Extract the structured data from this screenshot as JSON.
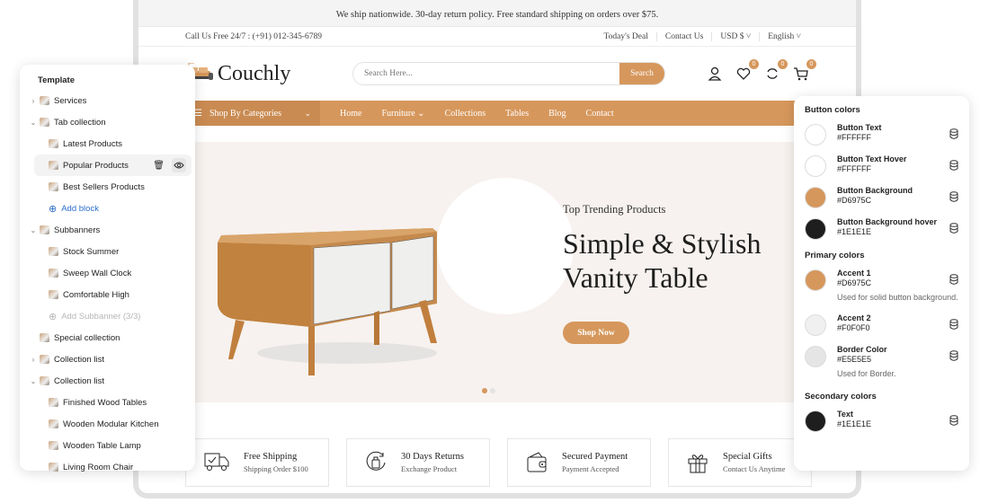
{
  "store": {
    "announcement": "We ship nationwide. 30-day return policy. Free standard shipping on orders over $75.",
    "phone": "Call Us Free 24/7 : (+91) 012-345-6789",
    "top_links": [
      "Today's Deal",
      "Contact Us",
      "USD $ ˅",
      "English ˅"
    ],
    "logo": "Couchly",
    "search": {
      "placeholder": "Search Here...",
      "button": "Search"
    },
    "header_icons": [
      {
        "name": "account-icon",
        "badge": null
      },
      {
        "name": "wishlist-icon",
        "badge": "0"
      },
      {
        "name": "compare-icon",
        "badge": "0"
      },
      {
        "name": "cart-icon",
        "badge": "0"
      }
    ],
    "categories_label": "Shop By Categories",
    "menu": [
      "Home",
      "Furniture",
      "Collections",
      "Tables",
      "Blog",
      "Contact"
    ],
    "hero": {
      "subtitle": "Top Trending Products",
      "title_line1": "Simple & Stylish",
      "title_line2": "Vanity Table",
      "button": "Shop Now",
      "slides": 2,
      "active_slide": 1
    },
    "services": [
      {
        "icon": "truck-icon",
        "title": "Free Shipping",
        "subtitle": "Shipping Order $100"
      },
      {
        "icon": "returns-icon",
        "title": "30 Days Returns",
        "subtitle": "Exchange Product"
      },
      {
        "icon": "wallet-icon",
        "title": "Secured Payment",
        "subtitle": "Payment Accepted"
      },
      {
        "icon": "gift-icon",
        "title": "Special Gifts",
        "subtitle": "Contact Us Anytime"
      }
    ]
  },
  "template_panel": {
    "title": "Template",
    "items": [
      {
        "label": "Services",
        "level": 1,
        "caret": ">"
      },
      {
        "label": "Tab collection",
        "level": 1,
        "caret": "v"
      },
      {
        "label": "Latest Products",
        "level": 2
      },
      {
        "label": "Popular Products",
        "level": 2,
        "selected": true
      },
      {
        "label": "Best Sellers Products",
        "level": 2
      },
      {
        "label": "Add block",
        "level": 2,
        "type": "add"
      },
      {
        "label": "Subbanners",
        "level": 1,
        "caret": "v"
      },
      {
        "label": "Stock Summer",
        "level": 2
      },
      {
        "label": "Sweep Wall Clock",
        "level": 2
      },
      {
        "label": "Comfortable High",
        "level": 2
      },
      {
        "label": "Add Subbanner (3/3)",
        "level": 2,
        "type": "add-disabled"
      },
      {
        "label": "Special collection",
        "level": 1
      },
      {
        "label": "Collection list",
        "level": 1,
        "caret": ">"
      },
      {
        "label": "Collection list",
        "level": 1,
        "caret": "v"
      },
      {
        "label": "Finished Wood Tables",
        "level": 2
      },
      {
        "label": "Wooden Modular Kitchen",
        "level": 2
      },
      {
        "label": "Wooden Table Lamp",
        "level": 2
      },
      {
        "label": "Living Room Chair",
        "level": 2
      }
    ]
  },
  "colors_panel": {
    "sections": [
      {
        "title": "Button colors",
        "swatches": [
          {
            "name": "Button Text",
            "hex": "#FFFFFF"
          },
          {
            "name": "Button Text Hover",
            "hex": "#FFFFFF"
          },
          {
            "name": "Button Background",
            "hex": "#D6975C"
          },
          {
            "name": "Button Background hover",
            "hex": "#1E1E1E"
          }
        ]
      },
      {
        "title": "Primary colors",
        "swatches": [
          {
            "name": "Accent 1",
            "hex": "#D6975C",
            "desc": "Used for solid button background."
          },
          {
            "name": "Accent 2",
            "hex": "#F0F0F0"
          },
          {
            "name": "Border Color",
            "hex": "#E5E5E5",
            "desc": "Used for Border."
          }
        ]
      },
      {
        "title": "Secondary colors",
        "swatches": [
          {
            "name": "Text",
            "hex": "#1E1E1E"
          }
        ]
      }
    ]
  }
}
